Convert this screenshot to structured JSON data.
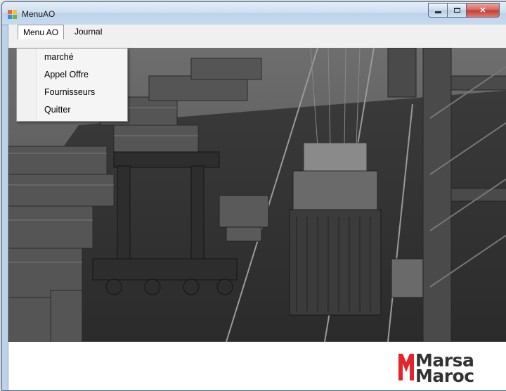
{
  "window": {
    "title": "MenuAO"
  },
  "menubar": {
    "items": [
      {
        "label": "Menu AO",
        "open": true
      },
      {
        "label": "Journal"
      }
    ]
  },
  "dropdown": {
    "items": [
      "marché",
      "Appel Offre",
      "Fournisseurs",
      "Quitter"
    ]
  },
  "background_image": {
    "description_icon": "port-container-terminal-photo"
  },
  "logo": {
    "line1": "Marsa",
    "line2": "Maroc",
    "accent_color": "#e4232a"
  },
  "colors": {
    "title_bar": "#cfdff0",
    "close_button": "#c4392f"
  }
}
